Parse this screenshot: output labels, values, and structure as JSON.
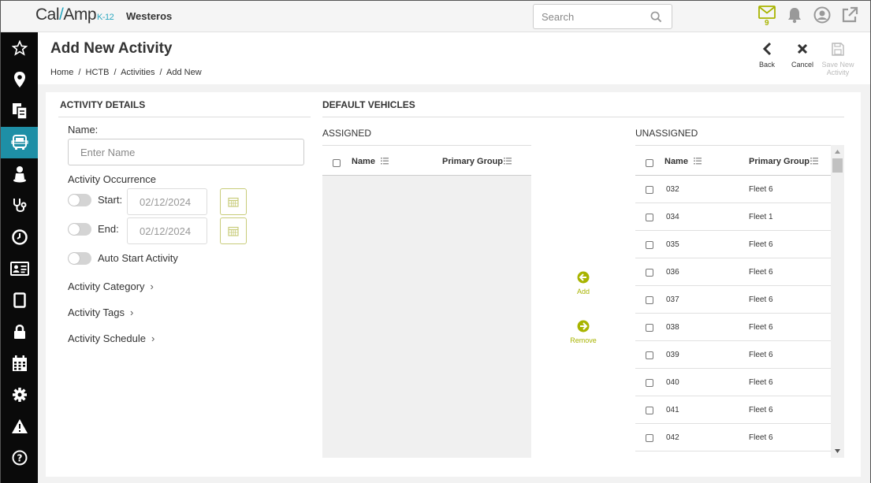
{
  "topbar": {
    "logo_cal": "Cal",
    "logo_slash": "/",
    "logo_amp": "Amp",
    "logo_suffix": "K-12",
    "org_name": "Westeros",
    "search_placeholder": "Search",
    "mail_count": "9"
  },
  "sidebar": {
    "items": [
      {
        "icon": "star-icon"
      },
      {
        "icon": "map-pin-icon"
      },
      {
        "icon": "documents-icon"
      },
      {
        "icon": "bus-icon",
        "active": true
      },
      {
        "icon": "student-icon"
      },
      {
        "icon": "stethoscope-icon"
      },
      {
        "icon": "clock-icon"
      },
      {
        "icon": "id-card-icon"
      },
      {
        "icon": "tablet-icon"
      },
      {
        "icon": "lock-icon"
      },
      {
        "icon": "calendar-icon"
      },
      {
        "icon": "gear-icon"
      },
      {
        "icon": "warning-icon"
      },
      {
        "icon": "help-icon"
      }
    ]
  },
  "header": {
    "title": "Add New Activity",
    "breadcrumb": [
      "Home",
      "/",
      "HCTB",
      "/",
      "Activities",
      "/",
      "Add New"
    ],
    "back_label": "Back",
    "cancel_label": "Cancel",
    "save_label_line1": "Save New",
    "save_label_line2": "Activity"
  },
  "details": {
    "section_title": "ACTIVITY DETAILS",
    "name_label": "Name:",
    "name_placeholder": "Enter Name",
    "occurrence_label": "Activity Occurrence",
    "start_label": "Start:",
    "start_date": "02/12/2024",
    "end_label": "End:",
    "end_date": "02/12/2024",
    "auto_start_label": "Auto Start Activity",
    "category_label": "Activity Category",
    "tags_label": "Activity Tags",
    "schedule_label": "Activity Schedule",
    "chevron": "›"
  },
  "vehicles": {
    "section_title": "DEFAULT VEHICLES",
    "assigned_title": "ASSIGNED",
    "unassigned_title": "UNASSIGNED",
    "col_name": "Name",
    "col_group": "Primary Group",
    "add_label": "Add",
    "remove_label": "Remove",
    "accent_color": "#a8b400",
    "unassigned_rows": [
      {
        "name": "032",
        "group": "Fleet 6"
      },
      {
        "name": "034",
        "group": "Fleet 1"
      },
      {
        "name": "035",
        "group": "Fleet 6"
      },
      {
        "name": "036",
        "group": "Fleet 6"
      },
      {
        "name": "037",
        "group": "Fleet 6"
      },
      {
        "name": "038",
        "group": "Fleet 6"
      },
      {
        "name": "039",
        "group": "Fleet 6"
      },
      {
        "name": "040",
        "group": "Fleet 6"
      },
      {
        "name": "041",
        "group": "Fleet 6"
      },
      {
        "name": "042",
        "group": "Fleet 6"
      }
    ]
  }
}
